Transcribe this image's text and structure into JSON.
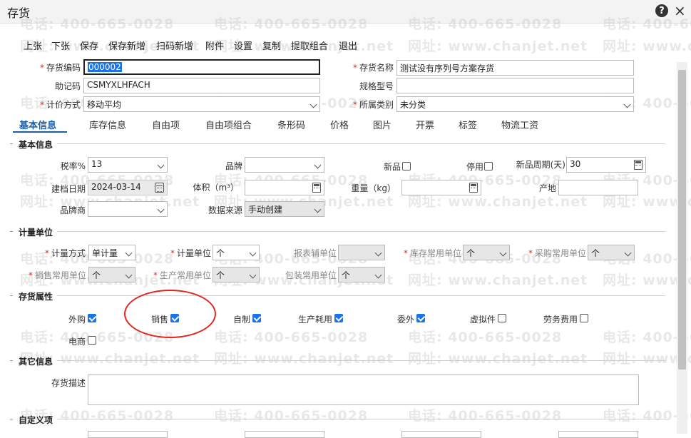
{
  "window": {
    "title": "存货",
    "help_icon": "help-icon",
    "close_icon": "close-icon"
  },
  "watermark": {
    "phone": "电话: 400-665-0028",
    "site": "网址: www.chanjet.net"
  },
  "toolbar": [
    "上张",
    "下张",
    "保存",
    "保存新增",
    "扫码新增",
    "附件",
    "设置",
    "复制",
    "提取组合",
    "退出"
  ],
  "header": {
    "code_label": "存货编码",
    "code_value": "000002",
    "name_label": "存货名称",
    "name_value": "测试没有序列号方案存货",
    "mnemonic_label": "助记码",
    "mnemonic_value": "CSMYXLHFACH",
    "spec_label": "规格型号",
    "spec_value": "",
    "pricing_label": "计价方式",
    "pricing_value": "移动平均",
    "category_label": "所属类别",
    "category_value": "未分类"
  },
  "tabs": [
    "基本信息",
    "库存信息",
    "自由项",
    "自由项组合",
    "条形码",
    "价格",
    "图片",
    "开票",
    "标签",
    "物流工资"
  ],
  "basic": {
    "section": "基本信息",
    "tax_label": "税率%",
    "tax_value": "13",
    "brand_label": "品牌",
    "brand_value": "",
    "new_label": "新品",
    "disabled_label": "停用",
    "period_label": "新品周期(天)",
    "period_value": "30",
    "date_label": "建档日期",
    "date_value": "2024-03-14",
    "volume_label": "体积（m³）",
    "volume_value": "",
    "weight_label": "重量（kg）",
    "weight_value": "",
    "origin_label": "产地",
    "origin_value": "",
    "brandowner_label": "品牌商",
    "brandowner_value": "",
    "source_label": "数据来源",
    "source_value": "手动创建"
  },
  "units": {
    "section": "计量单位",
    "method_label": "计量方式",
    "method_value": "单计量",
    "unit_label": "计量单位",
    "unit_value": "个",
    "report_label": "报表辅单位",
    "report_value": "",
    "stock_label": "库存常用单位",
    "stock_value": "个",
    "purchase_label": "采购常用单位",
    "purchase_value": "个",
    "sales_label": "销售常用单位",
    "sales_value": "个",
    "production_label": "生产常用单位",
    "production_value": "个",
    "package_label": "包装常用单位",
    "package_value": "个"
  },
  "attributes": {
    "section": "存货属性",
    "items": [
      {
        "label": "外购",
        "checked": true
      },
      {
        "label": "销售",
        "checked": true
      },
      {
        "label": "自制",
        "checked": true
      },
      {
        "label": "生产耗用",
        "checked": true
      },
      {
        "label": "委外",
        "checked": true
      },
      {
        "label": "虚拟件",
        "checked": false
      },
      {
        "label": "劳务费用",
        "checked": false
      },
      {
        "label": "电商",
        "checked": false
      }
    ]
  },
  "other": {
    "section": "其它信息",
    "desc_label": "存货描述",
    "desc_value": ""
  },
  "custom": {
    "section": "自定义项"
  },
  "colors": {
    "accent": "#1e5fa8",
    "required": "#d9302c",
    "annotation": "#e0261f",
    "checkbox": "#1a73e8"
  }
}
